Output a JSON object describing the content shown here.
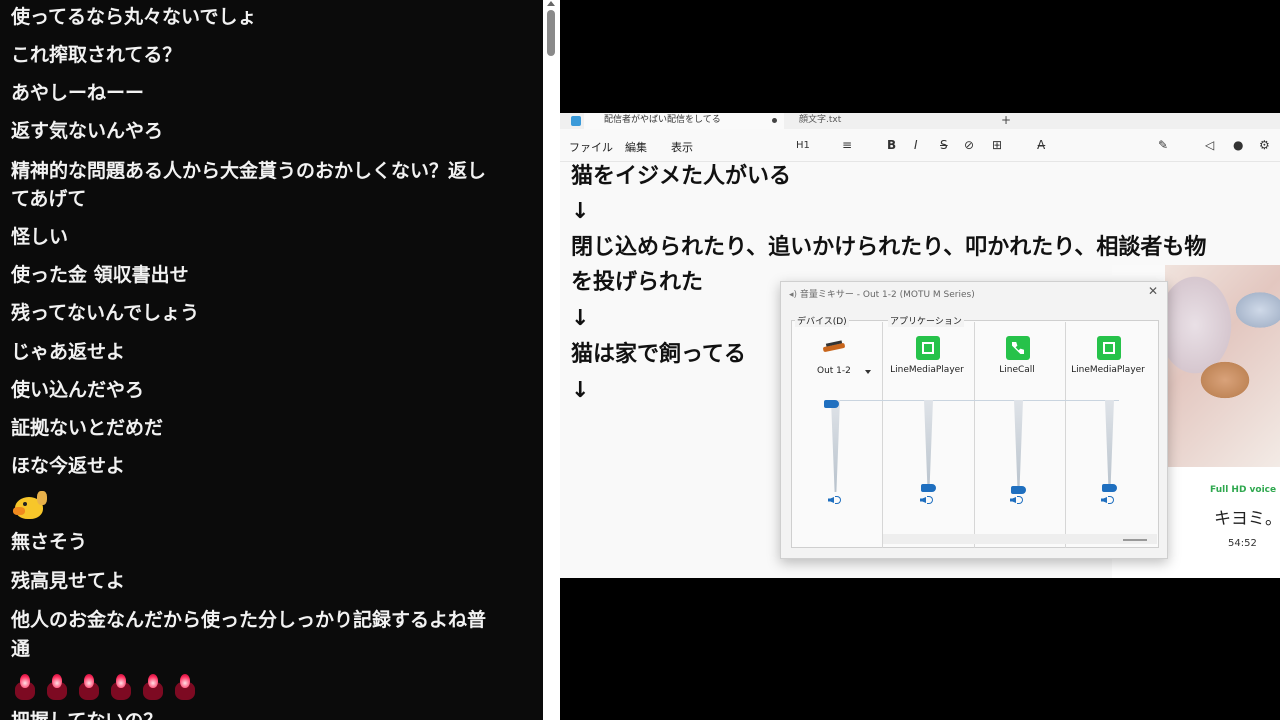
{
  "chat": {
    "messages": [
      "使ってるなら丸々ないでしょ",
      "これ搾取されてる？",
      "あやしーねーー",
      "返す気ないんやろ",
      "精神的な問題ある人から大金貰うのおかしくない？返し",
      "てあげて",
      "怪しい",
      "使った金 領収書出せ",
      "残ってないんでしょう",
      "じゃあ返せよ",
      "使い込んだやろ",
      "証拠ないとだめだ",
      "ほな今返せよ",
      "無さそう",
      "残高見せてよ",
      "他人のお金なんだから使った分しっかり記録するよね普",
      "通",
      "把握してないの？"
    ],
    "emoji_rows": [
      {
        "icons": [
          "duck-emoji"
        ]
      },
      {
        "icons": [
          "red-candle-emoji",
          "red-candle-emoji",
          "red-candle-emoji",
          "red-candle-emoji",
          "red-candle-emoji",
          "red-candle-emoji"
        ]
      }
    ]
  },
  "notepad": {
    "tabs": [
      {
        "label": "配信者がやばい配信をしてる",
        "active": true,
        "modified": true
      },
      {
        "label": "顔文字.txt",
        "active": false
      }
    ],
    "new_tab": "+",
    "menu": [
      "ファイル",
      "編集",
      "表示"
    ],
    "toolbar": {
      "heading": "H1",
      "list": "≡",
      "bold": "B",
      "italic": "I",
      "strike": "S",
      "link": "⊘",
      "table": "⊞",
      "clear": "A̶"
    },
    "lines": [
      "猫をイジメた人がいる",
      "↓",
      "閉じ込められたり、追いかけられたり、叩かれたり、相談者も物",
      "を投げられた",
      "↓",
      "猫は家で飼ってる",
      "↓"
    ]
  },
  "mixer": {
    "title": "音量ミキサー - Out 1-2 (MOTU M Series)",
    "close": "✕",
    "device_section": "デバイス(D)",
    "apps_section": "アプリケーション",
    "device": {
      "label": "Out 1-2",
      "level": 1.0
    },
    "apps": [
      {
        "name": "LineMediaPlayer",
        "icon": "media-player-icon",
        "level": 0.02
      },
      {
        "name": "LineCall",
        "icon": "phone-icon",
        "level": 0.0
      },
      {
        "name": "LineMediaPlayer",
        "icon": "media-player-icon",
        "level": 0.02
      }
    ],
    "accent": "#1f6fbf"
  },
  "webcam": {
    "badge": "Full HD voice",
    "name": "キヨミ。",
    "time": "54:52"
  }
}
